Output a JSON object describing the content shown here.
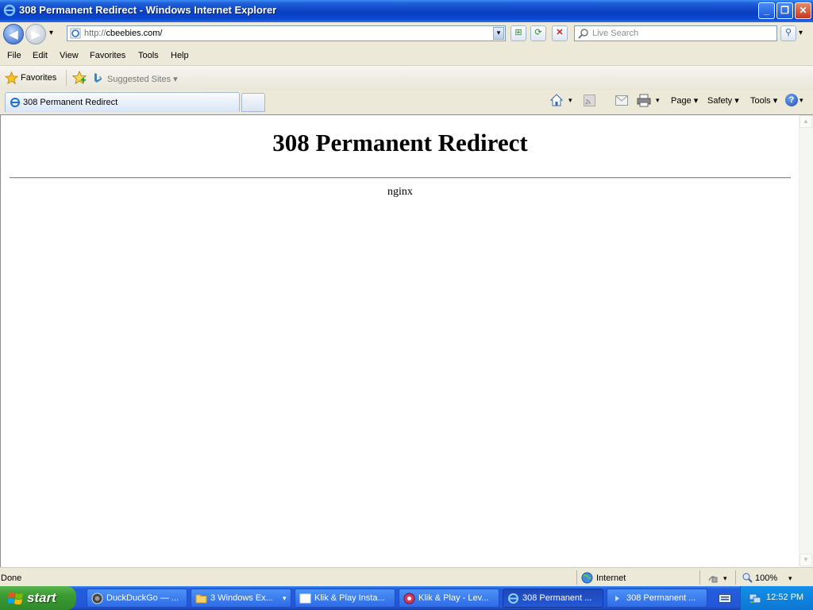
{
  "window": {
    "title": "308 Permanent Redirect - Windows Internet Explorer",
    "minimize_glyph": "_",
    "maximize_glyph": "❐",
    "close_glyph": "✕"
  },
  "toolbar": {
    "back_glyph": "◀",
    "forward_glyph": "▶",
    "url_protocol": "http://",
    "url_host": "cbeebies.com/",
    "search_placeholder": "Live Search",
    "compat_glyph": "⊞",
    "refresh_glyph": "⟳",
    "stop_glyph": "✕",
    "search_go_glyph": "⚲",
    "dropdown_glyph": "▾"
  },
  "menu": {
    "items": [
      "File",
      "Edit",
      "View",
      "Favorites",
      "Tools",
      "Help"
    ]
  },
  "favorites_bar": {
    "favorites_label": "Favorites",
    "suggested_label": "Suggested Sites ▾"
  },
  "tabs": {
    "active_label": "308 Permanent Redirect"
  },
  "command_bar": {
    "page_label": "Page ▾",
    "safety_label": "Safety ▾",
    "tools_label": "Tools ▾",
    "help_glyph": "?"
  },
  "page": {
    "heading": "308 Permanent Redirect",
    "server": "nginx"
  },
  "status": {
    "text": "Done",
    "zone": "Internet",
    "zoom": "100%"
  },
  "taskbar": {
    "start_label": "start",
    "tasks": [
      "DuckDuckGo — ...",
      "3 Windows Ex...",
      "Klik & Play Insta...",
      "Klik & Play - Lev...",
      "308 Permanent ...",
      "308 Permanent ..."
    ],
    "clock": "12:52 PM"
  },
  "colors": {
    "title_bar": "#0a3fc1",
    "taskbar": "#245edc",
    "start_button": "#3a9a32",
    "chrome": "#ece9d8"
  }
}
